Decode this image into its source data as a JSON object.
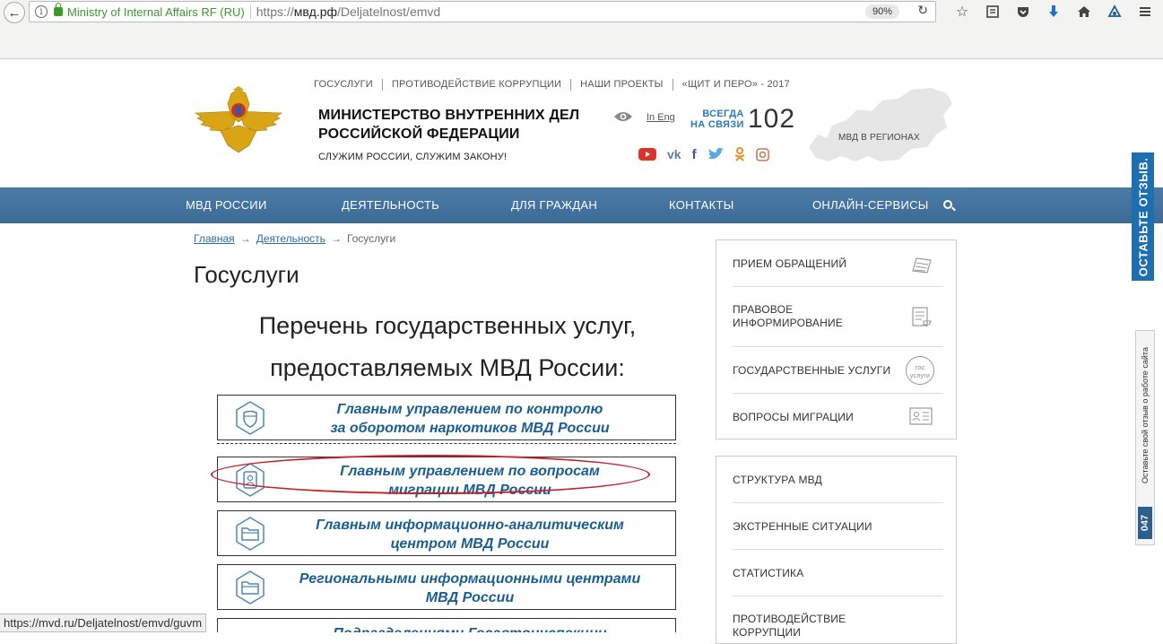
{
  "browser": {
    "site_identity": "Ministry of Internal Affairs RF (RU)",
    "url_prefix": "https://",
    "url_host": "мвд.рф",
    "url_path": "/Deljatelnost/emvd",
    "zoom": "90%",
    "status_url": "https://mvd.ru/Deljatelnost/emvd/guvm",
    "toolbar_icons": [
      "star-icon",
      "reading-list-icon",
      "pocket-icon",
      "download-icon",
      "home-icon",
      "sync-icon",
      "menu-icon"
    ]
  },
  "header": {
    "top_links": [
      "ГОСУСЛУГИ",
      "ПРОТИВОДЕЙСТВИЕ КОРРУПЦИИ",
      "НАШИ ПРОЕКТЫ",
      "«ЩИТ И ПЕРО» - 2017"
    ],
    "title_line1": "МИНИСТЕРСТВО ВНУТРЕННИХ ДЕЛ",
    "title_line2": "РОССИЙСКОЙ ФЕДЕРАЦИИ",
    "slogan": "СЛУЖИМ РОССИИ, СЛУЖИМ ЗАКОНУ!",
    "lang": "In Eng",
    "hotline_line1": "ВСЕГДА",
    "hotline_line2": "НА СВЯЗИ",
    "hotline_number": "102",
    "regions_label": "МВД В РЕГИОНАХ"
  },
  "nav": {
    "items": [
      "МВД РОССИИ",
      "ДЕЯТЕЛЬНОСТЬ",
      "ДЛЯ ГРАЖДАН",
      "КОНТАКТЫ",
      "ОНЛАЙН-СЕРВИСЫ"
    ]
  },
  "breadcrumb": {
    "home": "Главная",
    "section": "Деятельность",
    "current": "Госуслуги",
    "arrow": "→"
  },
  "main": {
    "page_title": "Госуслуги",
    "heading_line1": "Перечень государственных услуг,",
    "heading_line2": "предоставляемых МВД России:",
    "services": [
      {
        "line1": "Главным управлением по контролю",
        "line2": "за оборотом наркотиков МВД России"
      },
      {
        "line1": "Главным управлением по вопросам",
        "line2": "миграции МВД России"
      },
      {
        "line1": "Главным информационно-аналитическим",
        "line2": "центром МВД России"
      },
      {
        "line1": "Региональными информационными центрами",
        "line2": "МВД России"
      },
      {
        "line1": "Подразделениями Госавтоинспекции",
        "line2": ""
      }
    ]
  },
  "sidebar": {
    "panel1": [
      {
        "label": "ПРИЕМ ОБРАЩЕНИЙ"
      },
      {
        "label": "ПРАВОВОЕ\nИНФОРМИРОВАНИЕ"
      },
      {
        "label": "ГОСУДАРСТВЕННЫЕ УСЛУГИ",
        "badge": "гос услуги"
      },
      {
        "label": "ВОПРОСЫ МИГРАЦИИ"
      }
    ],
    "panel2": [
      {
        "label": "СТРУКТУРА МВД"
      },
      {
        "label": "ЭКСТРЕННЫЕ СИТУАЦИИ"
      },
      {
        "label": "СТАТИСТИКА"
      },
      {
        "label": "ПРОТИВОДЕЙСТВИЕ\nКОРРУПЦИИ"
      }
    ]
  },
  "feedback": {
    "tab_label": "ОСТАВЬТЕ ОТЗЫВ.",
    "side_text": "Оставьте свой отзыв о работе сайта",
    "counter": "047"
  }
}
